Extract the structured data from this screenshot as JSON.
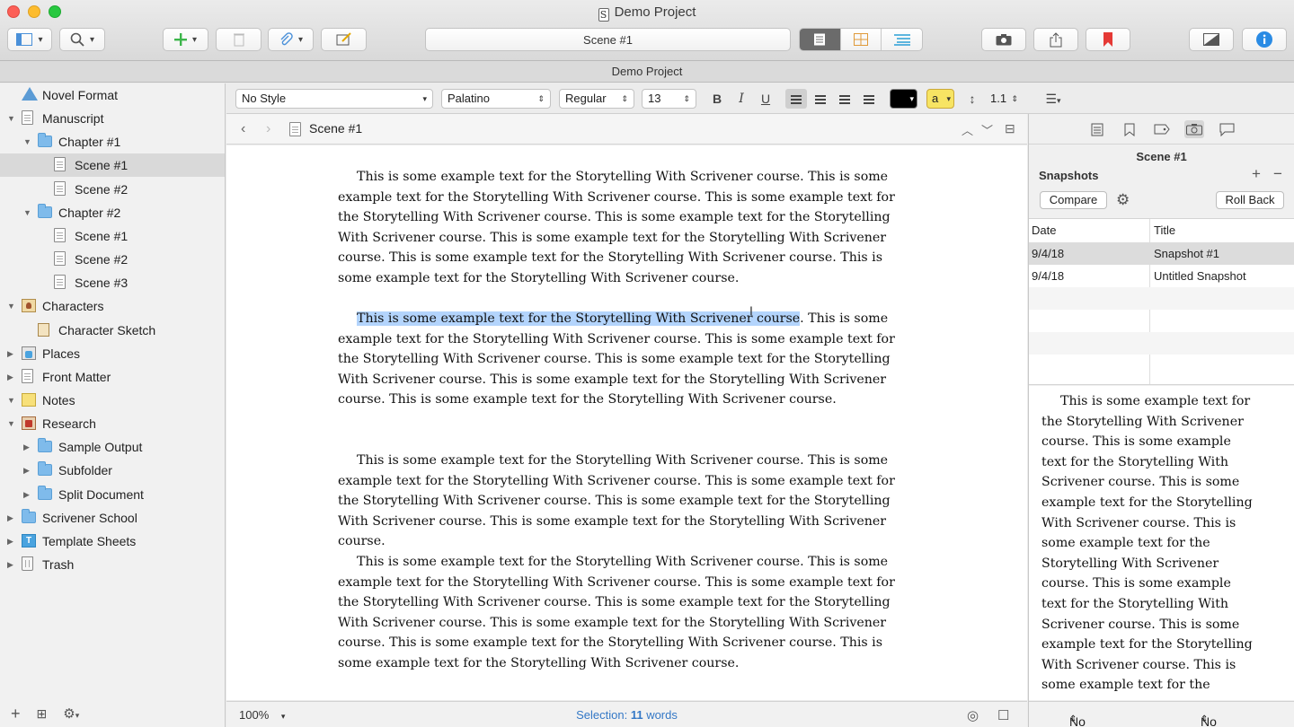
{
  "window": {
    "title": "Demo Project"
  },
  "toolbar": {
    "scene_field": "Scene #1"
  },
  "header_strip": {
    "title": "Demo Project"
  },
  "binder": {
    "items": [
      {
        "label": "Novel Format",
        "indent": 0,
        "disclosure": "",
        "icon": "warn"
      },
      {
        "label": "Manuscript",
        "indent": 0,
        "disclosure": "open",
        "icon": "doc"
      },
      {
        "label": "Chapter #1",
        "indent": 1,
        "disclosure": "open",
        "icon": "folder"
      },
      {
        "label": "Scene #1",
        "indent": 2,
        "disclosure": "",
        "icon": "doc",
        "selected": true
      },
      {
        "label": "Scene #2",
        "indent": 2,
        "disclosure": "",
        "icon": "doc"
      },
      {
        "label": "Chapter #2",
        "indent": 1,
        "disclosure": "open",
        "icon": "folder"
      },
      {
        "label": "Scene #1",
        "indent": 2,
        "disclosure": "",
        "icon": "doc"
      },
      {
        "label": "Scene #2",
        "indent": 2,
        "disclosure": "",
        "icon": "doc"
      },
      {
        "label": "Scene #3",
        "indent": 2,
        "disclosure": "",
        "icon": "doc"
      },
      {
        "label": "Characters",
        "indent": 0,
        "disclosure": "open",
        "icon": "char"
      },
      {
        "label": "Character Sketch",
        "indent": 1,
        "disclosure": "",
        "icon": "sheet"
      },
      {
        "label": "Places",
        "indent": 0,
        "disclosure": "closed",
        "icon": "places"
      },
      {
        "label": "Front Matter",
        "indent": 0,
        "disclosure": "closed",
        "icon": "doc"
      },
      {
        "label": "Notes",
        "indent": 0,
        "disclosure": "open",
        "icon": "notes"
      },
      {
        "label": "Research",
        "indent": 0,
        "disclosure": "open",
        "icon": "research"
      },
      {
        "label": "Sample Output",
        "indent": 1,
        "disclosure": "closed",
        "icon": "folder"
      },
      {
        "label": "Subfolder",
        "indent": 1,
        "disclosure": "closed",
        "icon": "folder"
      },
      {
        "label": "Split Document",
        "indent": 1,
        "disclosure": "closed",
        "icon": "folder"
      },
      {
        "label": "Scrivener School",
        "indent": 0,
        "disclosure": "closed",
        "icon": "folder"
      },
      {
        "label": "Template Sheets",
        "indent": 0,
        "disclosure": "closed",
        "icon": "template"
      },
      {
        "label": "Trash",
        "indent": 0,
        "disclosure": "closed",
        "icon": "trash"
      }
    ],
    "template_icon_letter": "T"
  },
  "format_bar": {
    "style": "No Style",
    "font": "Palatino",
    "weight": "Regular",
    "size": "13",
    "bold": "B",
    "italic": "I",
    "underline": "U",
    "highlight_label": "a",
    "line_spacing": "1.1"
  },
  "editor": {
    "doc_title": "Scene #1",
    "paragraphs": [
      {
        "highlight": "",
        "text": "This is some example text for the Storytelling With Scrivener course. This is some example text for the Storytelling With Scrivener course. This is some example text for the Storytelling With Scrivener course. This is some example text for the Storytelling With Scrivener course. This is some example text for the Storytelling With Scrivener course. This is some example text for the Storytelling With Scrivener course. This is some example text for the Storytelling With Scrivener course."
      },
      {
        "highlight": "This is some example text for the Storytelling With Scrivener course",
        "text": ". This is some example text for the Storytelling With Scrivener course. This is some example text for the Storytelling With Scrivener course. This is some example text for the Storytelling With Scrivener course. This is some example text for the Storytelling With Scrivener course. This is some example text for the Storytelling With Scrivener course."
      },
      {
        "highlight": "",
        "text": "This is some example text for the Storytelling With Scrivener course. This is some example text for the Storytelling With Scrivener course. This is some example text for the Storytelling With Scrivener course. This is some example text for the Storytelling With Scrivener course. This is some example text for the Storytelling With Scrivener course."
      },
      {
        "highlight": "",
        "text": "This is some example text for the Storytelling With Scrivener course. This is some example text for the Storytelling With Scrivener course. This is some example text for the Storytelling With Scrivener course. This is some example text for the Storytelling With Scrivener course. This is some example text for the Storytelling With Scrivener course. This is some example text for the Storytelling With Scrivener course. This is some example text for the Storytelling With Scrivener course."
      }
    ],
    "zoom": "100%",
    "selection_prefix": "Selection: ",
    "selection_count": "11",
    "selection_suffix": " words"
  },
  "inspector": {
    "doc_title": "Scene #1",
    "snapshots_heading": "Snapshots",
    "add": "+",
    "remove": "−",
    "compare": "Compare",
    "roll_back": "Roll Back",
    "columns": {
      "date": "Date",
      "title": "Title"
    },
    "snapshots": [
      {
        "date": "9/4/18",
        "title": "Snapshot #1"
      },
      {
        "date": "9/4/18",
        "title": "Untitled Snapshot"
      }
    ],
    "preview": "This is some example text for the Storytelling With Scrivener course. This is some example text for the Storytelling With Scrivener course. This is some example text for the Storytelling With Scrivener course. This is some example text for the Storytelling With Scrivener course. This is some example text for the Storytelling With Scrivener course. This is some example text for the Storytelling With Scrivener course. This is some example text for the",
    "label": "No Label",
    "status": "No Status"
  },
  "colors": {
    "accent": "#3478c6",
    "selection": "#b3d4fc",
    "bookmark": "#e53935",
    "info": "#2a8be4"
  }
}
